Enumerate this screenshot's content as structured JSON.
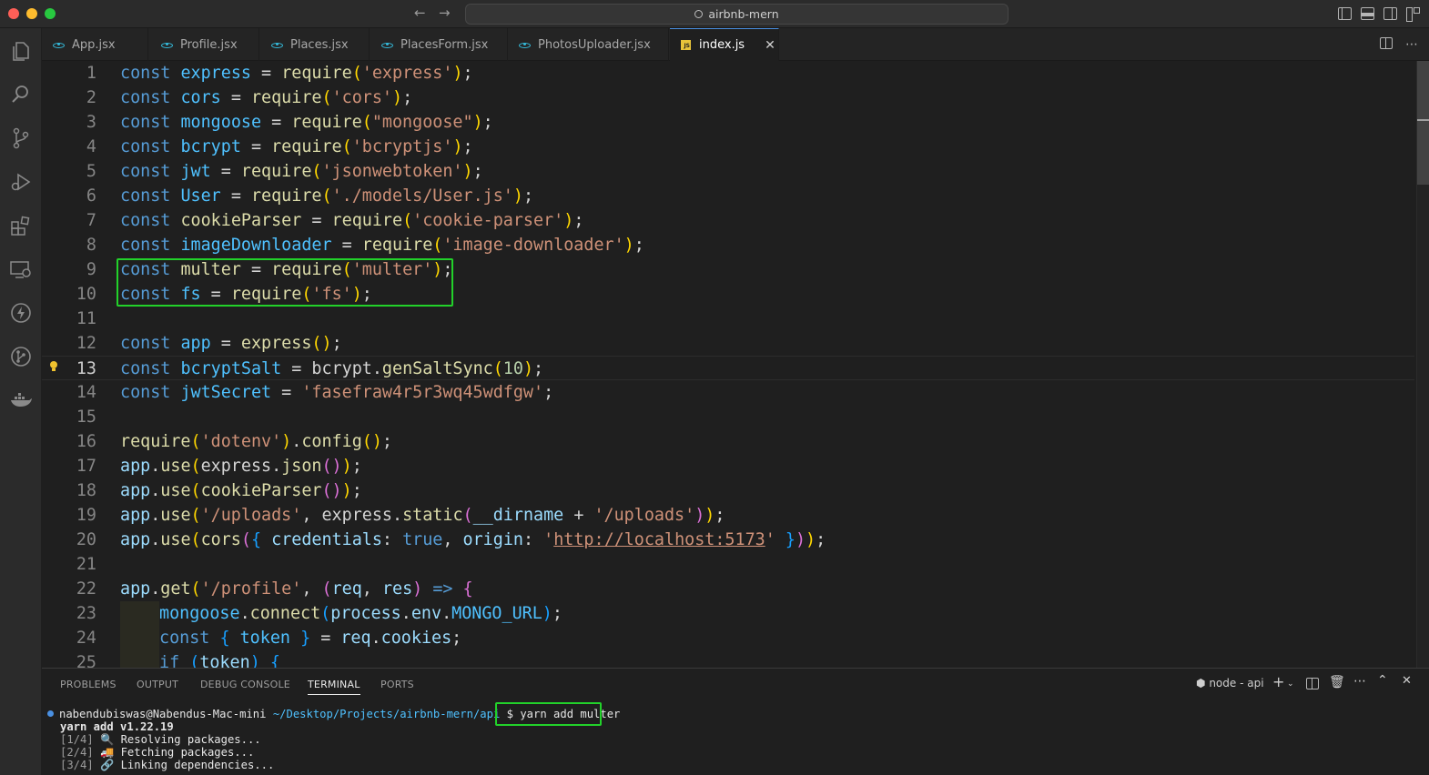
{
  "window": {
    "search_text": "airbnb-mern"
  },
  "tabs": [
    {
      "label": "App.jsx",
      "type": "react"
    },
    {
      "label": "Profile.jsx",
      "type": "react"
    },
    {
      "label": "Places.jsx",
      "type": "react"
    },
    {
      "label": "PlacesForm.jsx",
      "type": "react"
    },
    {
      "label": "PhotosUploader.jsx",
      "type": "react"
    },
    {
      "label": "index.js",
      "type": "js",
      "active": true
    }
  ],
  "editor": {
    "current_line": 13,
    "lines": [
      {
        "n": "1",
        "tokens": [
          [
            "kw",
            "const"
          ],
          [
            "plain",
            " "
          ],
          [
            "var",
            "express"
          ],
          [
            "op",
            " = "
          ],
          [
            "fn",
            "require"
          ],
          [
            "p1",
            "("
          ],
          [
            "str",
            "'express'"
          ],
          [
            "p1",
            ")"
          ],
          [
            "op",
            ";"
          ]
        ]
      },
      {
        "n": "2",
        "tokens": [
          [
            "kw",
            "const"
          ],
          [
            "plain",
            " "
          ],
          [
            "var",
            "cors"
          ],
          [
            "op",
            " = "
          ],
          [
            "fn",
            "require"
          ],
          [
            "p1",
            "("
          ],
          [
            "str",
            "'cors'"
          ],
          [
            "p1",
            ")"
          ],
          [
            "op",
            ";"
          ]
        ]
      },
      {
        "n": "3",
        "tokens": [
          [
            "kw",
            "const"
          ],
          [
            "plain",
            " "
          ],
          [
            "var",
            "mongoose"
          ],
          [
            "op",
            " = "
          ],
          [
            "fn",
            "require"
          ],
          [
            "p1",
            "("
          ],
          [
            "str",
            "\"mongoose\""
          ],
          [
            "p1",
            ")"
          ],
          [
            "op",
            ";"
          ]
        ]
      },
      {
        "n": "4",
        "tokens": [
          [
            "kw",
            "const"
          ],
          [
            "plain",
            " "
          ],
          [
            "var",
            "bcrypt"
          ],
          [
            "op",
            " = "
          ],
          [
            "fn",
            "require"
          ],
          [
            "p1",
            "("
          ],
          [
            "str",
            "'bcryptjs'"
          ],
          [
            "p1",
            ")"
          ],
          [
            "op",
            ";"
          ]
        ]
      },
      {
        "n": "5",
        "tokens": [
          [
            "kw",
            "const"
          ],
          [
            "plain",
            " "
          ],
          [
            "var",
            "jwt"
          ],
          [
            "op",
            " = "
          ],
          [
            "fn",
            "require"
          ],
          [
            "p1",
            "("
          ],
          [
            "str",
            "'jsonwebtoken'"
          ],
          [
            "p1",
            ")"
          ],
          [
            "op",
            ";"
          ]
        ]
      },
      {
        "n": "6",
        "tokens": [
          [
            "kw",
            "const"
          ],
          [
            "plain",
            " "
          ],
          [
            "var",
            "User"
          ],
          [
            "op",
            " = "
          ],
          [
            "fn",
            "require"
          ],
          [
            "p1",
            "("
          ],
          [
            "str",
            "'./models/User.js'"
          ],
          [
            "p1",
            ")"
          ],
          [
            "op",
            ";"
          ]
        ]
      },
      {
        "n": "7",
        "tokens": [
          [
            "kw",
            "const"
          ],
          [
            "plain",
            " "
          ],
          [
            "fn",
            "cookieParser"
          ],
          [
            "op",
            " = "
          ],
          [
            "fn",
            "require"
          ],
          [
            "p1",
            "("
          ],
          [
            "str",
            "'cookie-parser'"
          ],
          [
            "p1",
            ")"
          ],
          [
            "op",
            ";"
          ]
        ]
      },
      {
        "n": "8",
        "tokens": [
          [
            "kw",
            "const"
          ],
          [
            "plain",
            " "
          ],
          [
            "var",
            "imageDownloader"
          ],
          [
            "op",
            " = "
          ],
          [
            "fn",
            "require"
          ],
          [
            "p1",
            "("
          ],
          [
            "str",
            "'image-downloader'"
          ],
          [
            "p1",
            ")"
          ],
          [
            "op",
            ";"
          ]
        ]
      },
      {
        "n": "9",
        "tokens": [
          [
            "kw",
            "const"
          ],
          [
            "plain",
            " "
          ],
          [
            "fn",
            "multer"
          ],
          [
            "op",
            " = "
          ],
          [
            "fn",
            "require"
          ],
          [
            "p1",
            "("
          ],
          [
            "str",
            "'multer'"
          ],
          [
            "p1",
            ")"
          ],
          [
            "op",
            ";"
          ]
        ]
      },
      {
        "n": "10",
        "tokens": [
          [
            "kw",
            "const"
          ],
          [
            "plain",
            " "
          ],
          [
            "var",
            "fs"
          ],
          [
            "op",
            " = "
          ],
          [
            "fn",
            "require"
          ],
          [
            "p1",
            "("
          ],
          [
            "str",
            "'fs'"
          ],
          [
            "p1",
            ")"
          ],
          [
            "op",
            ";"
          ]
        ]
      },
      {
        "n": "11",
        "tokens": []
      },
      {
        "n": "12",
        "tokens": [
          [
            "kw",
            "const"
          ],
          [
            "plain",
            " "
          ],
          [
            "var",
            "app"
          ],
          [
            "op",
            " = "
          ],
          [
            "fn",
            "express"
          ],
          [
            "p1",
            "()"
          ],
          [
            "op",
            ";"
          ]
        ]
      },
      {
        "n": "13",
        "tokens": [
          [
            "kw",
            "const"
          ],
          [
            "plain",
            " "
          ],
          [
            "var",
            "bcryptSalt"
          ],
          [
            "op",
            " = "
          ],
          [
            "plain",
            "bcrypt"
          ],
          [
            "op",
            "."
          ],
          [
            "fn",
            "genSaltSync"
          ],
          [
            "p1",
            "("
          ],
          [
            "num",
            "10"
          ],
          [
            "p1",
            ")"
          ],
          [
            "op",
            ";"
          ]
        ]
      },
      {
        "n": "14",
        "tokens": [
          [
            "kw",
            "const"
          ],
          [
            "plain",
            " "
          ],
          [
            "var",
            "jwtSecret"
          ],
          [
            "op",
            " = "
          ],
          [
            "str",
            "'fasefraw4r5r3wq45wdfgw'"
          ],
          [
            "op",
            ";"
          ]
        ]
      },
      {
        "n": "15",
        "tokens": []
      },
      {
        "n": "16",
        "tokens": [
          [
            "fn",
            "require"
          ],
          [
            "p1",
            "("
          ],
          [
            "str",
            "'dotenv'"
          ],
          [
            "p1",
            ")"
          ],
          [
            "op",
            "."
          ],
          [
            "fn",
            "config"
          ],
          [
            "p1",
            "()"
          ],
          [
            "op",
            ";"
          ]
        ]
      },
      {
        "n": "17",
        "tokens": [
          [
            "prop",
            "app"
          ],
          [
            "op",
            "."
          ],
          [
            "fn",
            "use"
          ],
          [
            "p1",
            "("
          ],
          [
            "plain",
            "express"
          ],
          [
            "op",
            "."
          ],
          [
            "fn",
            "json"
          ],
          [
            "p2",
            "()"
          ],
          [
            "p1",
            ")"
          ],
          [
            "op",
            ";"
          ]
        ]
      },
      {
        "n": "18",
        "tokens": [
          [
            "prop",
            "app"
          ],
          [
            "op",
            "."
          ],
          [
            "fn",
            "use"
          ],
          [
            "p1",
            "("
          ],
          [
            "fn",
            "cookieParser"
          ],
          [
            "p2",
            "()"
          ],
          [
            "p1",
            ")"
          ],
          [
            "op",
            ";"
          ]
        ]
      },
      {
        "n": "19",
        "tokens": [
          [
            "prop",
            "app"
          ],
          [
            "op",
            "."
          ],
          [
            "fn",
            "use"
          ],
          [
            "p1",
            "("
          ],
          [
            "str",
            "'/uploads'"
          ],
          [
            "op",
            ", "
          ],
          [
            "plain",
            "express"
          ],
          [
            "op",
            "."
          ],
          [
            "fn",
            "static"
          ],
          [
            "p2",
            "("
          ],
          [
            "prop",
            "__dirname"
          ],
          [
            "op",
            " + "
          ],
          [
            "str",
            "'/uploads'"
          ],
          [
            "p2",
            ")"
          ],
          [
            "p1",
            ")"
          ],
          [
            "op",
            ";"
          ]
        ]
      },
      {
        "n": "20",
        "tokens": [
          [
            "prop",
            "app"
          ],
          [
            "op",
            "."
          ],
          [
            "fn",
            "use"
          ],
          [
            "p1",
            "("
          ],
          [
            "fn",
            "cors"
          ],
          [
            "p2",
            "("
          ],
          [
            "p3",
            "{"
          ],
          [
            "plain",
            " "
          ],
          [
            "prop",
            "credentials"
          ],
          [
            "op",
            ": "
          ],
          [
            "kw",
            "true"
          ],
          [
            "op",
            ", "
          ],
          [
            "prop",
            "origin"
          ],
          [
            "op",
            ": "
          ],
          [
            "str",
            "'"
          ],
          [
            "link",
            "http://localhost:5173"
          ],
          [
            "str",
            "'"
          ],
          [
            "plain",
            " "
          ],
          [
            "p3",
            "}"
          ],
          [
            "p2",
            ")"
          ],
          [
            "p1",
            ")"
          ],
          [
            "op",
            ";"
          ]
        ]
      },
      {
        "n": "21",
        "tokens": []
      },
      {
        "n": "22",
        "tokens": [
          [
            "prop",
            "app"
          ],
          [
            "op",
            "."
          ],
          [
            "fn",
            "get"
          ],
          [
            "p1",
            "("
          ],
          [
            "str",
            "'/profile'"
          ],
          [
            "op",
            ", "
          ],
          [
            "p2",
            "("
          ],
          [
            "prop",
            "req"
          ],
          [
            "op",
            ", "
          ],
          [
            "prop",
            "res"
          ],
          [
            "p2",
            ")"
          ],
          [
            "plain",
            " "
          ],
          [
            "kw",
            "=>"
          ],
          [
            "plain",
            " "
          ],
          [
            "p2",
            "{"
          ]
        ]
      },
      {
        "n": "23",
        "indent": true,
        "tokens": [
          [
            "var",
            "mongoose"
          ],
          [
            "op",
            "."
          ],
          [
            "fn",
            "connect"
          ],
          [
            "p3",
            "("
          ],
          [
            "prop",
            "process"
          ],
          [
            "op",
            "."
          ],
          [
            "prop",
            "env"
          ],
          [
            "op",
            "."
          ],
          [
            "var",
            "MONGO_URL"
          ],
          [
            "p3",
            ")"
          ],
          [
            "op",
            ";"
          ]
        ]
      },
      {
        "n": "24",
        "indent": true,
        "tokens": [
          [
            "kw",
            "const"
          ],
          [
            "plain",
            " "
          ],
          [
            "p3",
            "{"
          ],
          [
            "plain",
            " "
          ],
          [
            "var",
            "token"
          ],
          [
            "plain",
            " "
          ],
          [
            "p3",
            "}"
          ],
          [
            "op",
            " = "
          ],
          [
            "prop",
            "req"
          ],
          [
            "op",
            "."
          ],
          [
            "prop",
            "cookies"
          ],
          [
            "op",
            ";"
          ]
        ]
      },
      {
        "n": "25",
        "indent": true,
        "tokens": [
          [
            "kw",
            "if"
          ],
          [
            "plain",
            " "
          ],
          [
            "p3",
            "("
          ],
          [
            "prop",
            "token"
          ],
          [
            "p3",
            ")"
          ],
          [
            "plain",
            " "
          ],
          [
            "p3",
            "{"
          ]
        ]
      }
    ]
  },
  "panel": {
    "tabs": [
      "PROBLEMS",
      "OUTPUT",
      "DEBUG CONSOLE",
      "TERMINAL",
      "PORTS"
    ],
    "active_tab": "TERMINAL",
    "terminal_name": "node - api",
    "prompt_user": "nabendubiswas@Nabendus-Mac-mini",
    "prompt_path": "~/Desktop/Projects/airbnb-mern/api",
    "prompt_symbol": "$",
    "command": "yarn add multer",
    "output": [
      {
        "step": "",
        "icon": "",
        "text": "yarn add v1.22.19",
        "bold": true
      },
      {
        "step": "[1/4]",
        "icon": "🔍",
        "text": "Resolving packages..."
      },
      {
        "step": "[2/4]",
        "icon": "🚚",
        "text": "Fetching packages..."
      },
      {
        "step": "[3/4]",
        "icon": "🔗",
        "text": "Linking dependencies..."
      }
    ]
  }
}
